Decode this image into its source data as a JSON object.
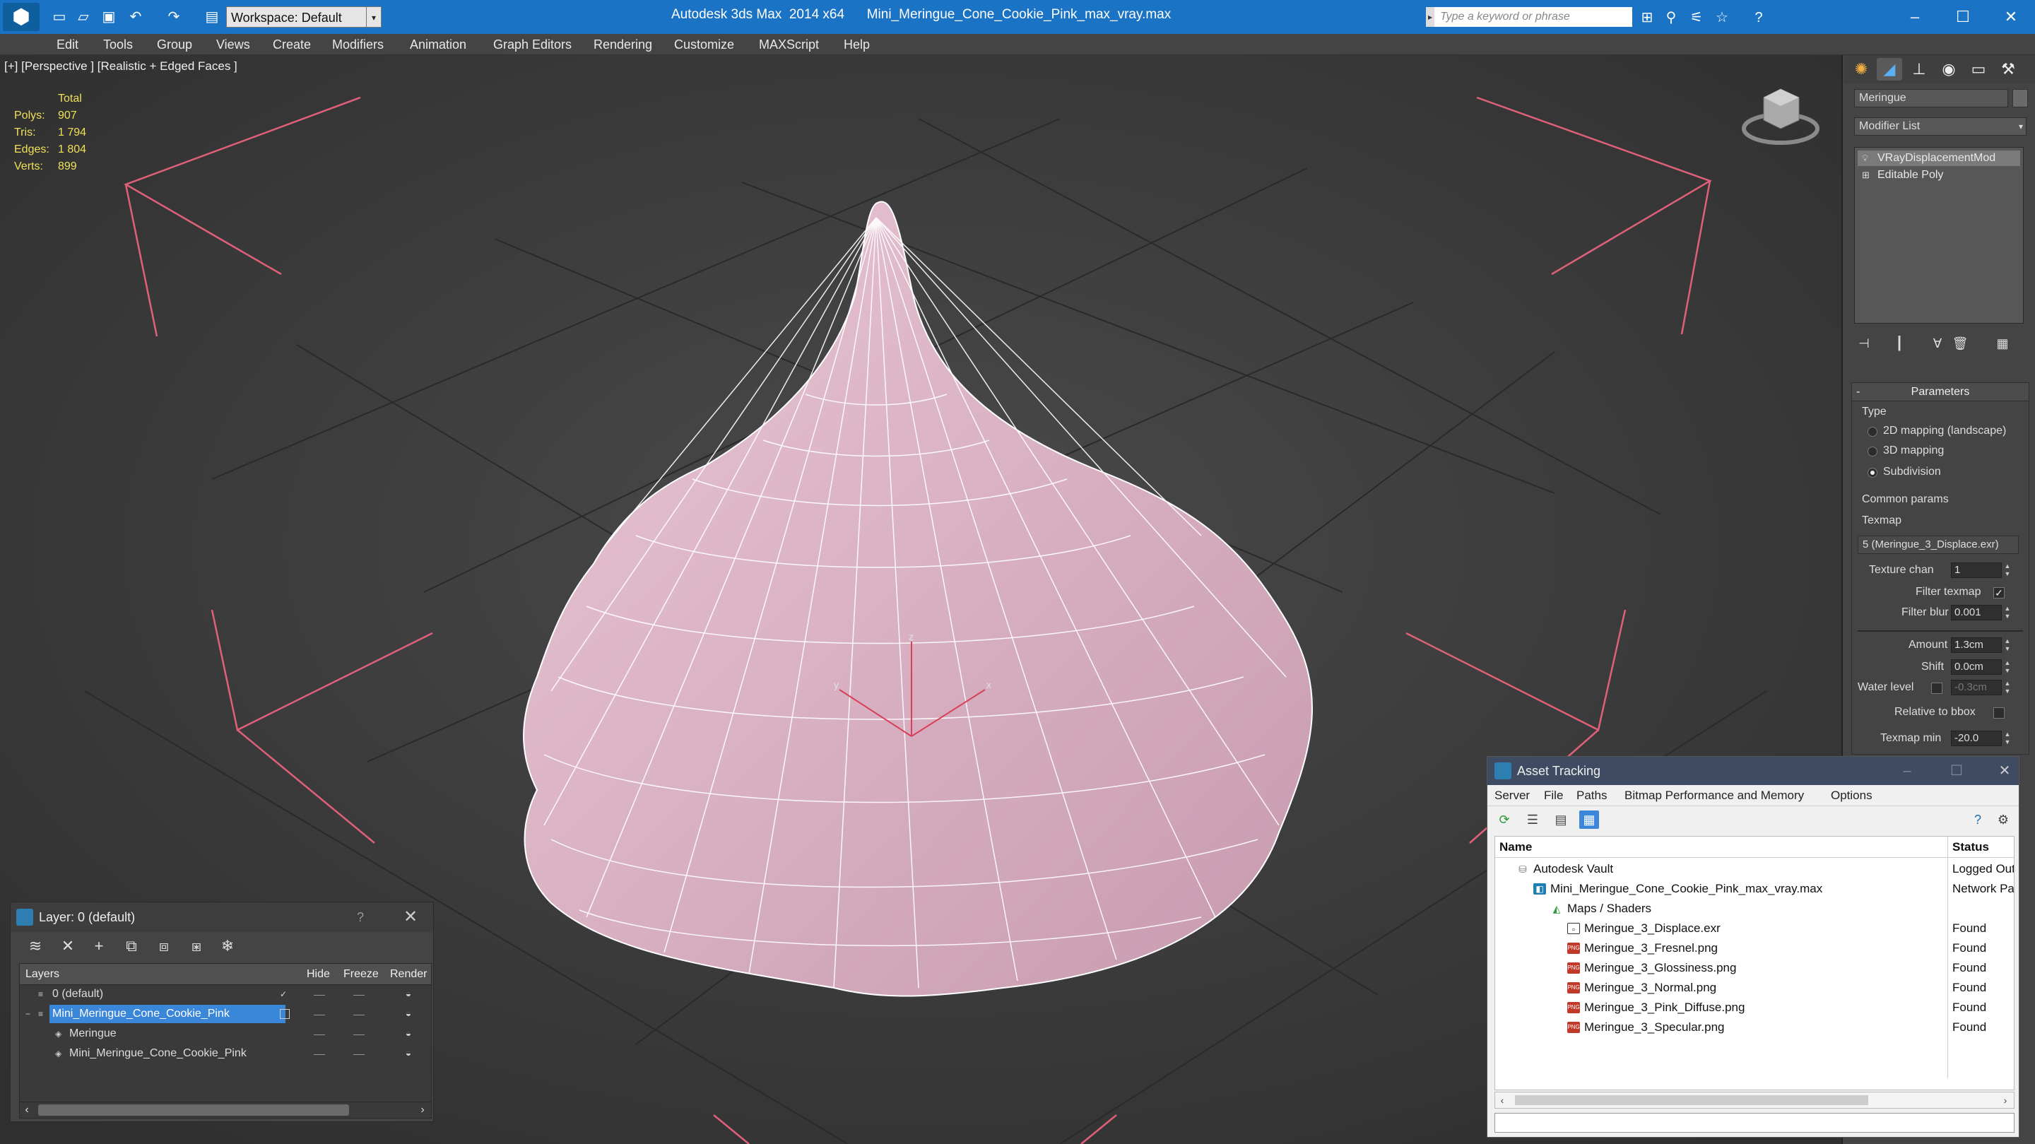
{
  "titlebar": {
    "workspace_label": "Workspace: Default",
    "app_title": "Autodesk 3ds Max  2014 x64      Mini_Meringue_Cone_Cookie_Pink_max_vray.max",
    "search_placeholder": "Type a keyword or phrase",
    "color": "#1a73c4"
  },
  "menubar": {
    "items": [
      "Edit",
      "Tools",
      "Group",
      "Views",
      "Create",
      "Modifiers",
      "Animation",
      "Graph Editors",
      "Rendering",
      "Customize",
      "MAXScript",
      "Help"
    ]
  },
  "viewport": {
    "label": "[+] [Perspective ] [Realistic + Edged Faces ]",
    "stats": {
      "header": "Total",
      "rows": [
        {
          "key": "Polys:",
          "value": "907"
        },
        {
          "key": "Tris:",
          "value": "1 794"
        },
        {
          "key": "Edges:",
          "value": "1 804"
        },
        {
          "key": "Verts:",
          "value": "899"
        }
      ]
    },
    "mesh_color": "#e9c7d6",
    "wire_color": "#ffffff",
    "bbox_color": "#e0607a",
    "axis_labels": {
      "x": "x",
      "y": "y",
      "z": "z"
    }
  },
  "command_panel": {
    "object_name": "Meringue",
    "modifier_list": "Modifier List",
    "stack": [
      {
        "label": "VRayDisplacementMod",
        "selected": true
      },
      {
        "label": "Editable Poly",
        "selected": false
      }
    ],
    "parameters": {
      "title": "Parameters",
      "type_label": "Type",
      "type_options": [
        {
          "label": "2D mapping (landscape)",
          "selected": false
        },
        {
          "label": "3D mapping",
          "selected": false
        },
        {
          "label": "Subdivision",
          "selected": true
        }
      ],
      "common_params": "Common params",
      "texmap_label": "Texmap",
      "texmap_value": "5 (Meringue_3_Displace.exr)",
      "texture_chan_label": "Texture chan",
      "texture_chan_value": "1",
      "filter_texmap_label": "Filter texmap",
      "filter_blur_label": "Filter blur",
      "filter_blur_value": "0.001",
      "amount_label": "Amount",
      "amount_value": "1.3cm",
      "shift_label": "Shift",
      "shift_value": "0.0cm",
      "water_level_label": "Water level",
      "water_level_value": "-0.3cm",
      "relative_bbox_label": "Relative to bbox",
      "texmap_min_label": "Texmap min",
      "texmap_min_value": "-20.0"
    }
  },
  "layer_window": {
    "title": "Layer: 0 (default)",
    "help": "?",
    "columns": [
      "Layers",
      "Hide",
      "Freeze",
      "Render"
    ],
    "rows": [
      {
        "name": "0 (default)",
        "indent": 0,
        "selected": false
      },
      {
        "name": "Mini_Meringue_Cone_Cookie_Pink",
        "indent": 0,
        "selected": true
      },
      {
        "name": "Meringue",
        "indent": 1,
        "selected": false
      },
      {
        "name": "Mini_Meringue_Cone_Cookie_Pink",
        "indent": 1,
        "selected": false
      }
    ]
  },
  "asset_tracking": {
    "title": "Asset Tracking",
    "menu": [
      "Server",
      "File",
      "Paths",
      "Bitmap Performance and Memory",
      "Options"
    ],
    "columns": {
      "name": "Name",
      "status": "Status"
    },
    "rows": [
      {
        "name": "Autodesk Vault",
        "status": "Logged Out",
        "indent": 1,
        "icon": "vault-icon"
      },
      {
        "name": "Mini_Meringue_Cone_Cookie_Pink_max_vray.max",
        "status": "Network Pat",
        "indent": 2,
        "icon": "max-file-icon"
      },
      {
        "name": "Maps / Shaders",
        "status": "",
        "indent": 3,
        "icon": "maps-folder-icon"
      },
      {
        "name": "Meringue_3_Displace.exr",
        "status": "Found",
        "indent": 4,
        "icon": "exr-file-icon"
      },
      {
        "name": "Meringue_3_Fresnel.png",
        "status": "Found",
        "indent": 4,
        "icon": "png-file-icon"
      },
      {
        "name": "Meringue_3_Glossiness.png",
        "status": "Found",
        "indent": 4,
        "icon": "png-file-icon"
      },
      {
        "name": "Meringue_3_Normal.png",
        "status": "Found",
        "indent": 4,
        "icon": "png-file-icon"
      },
      {
        "name": "Meringue_3_Pink_Diffuse.png",
        "status": "Found",
        "indent": 4,
        "icon": "png-file-icon"
      },
      {
        "name": "Meringue_3_Specular.png",
        "status": "Found",
        "indent": 4,
        "icon": "png-file-icon"
      }
    ]
  }
}
